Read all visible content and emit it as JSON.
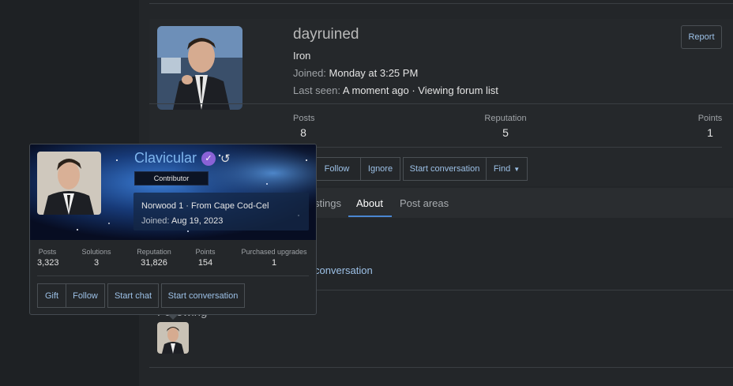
{
  "profile": {
    "username": "dayruined",
    "rank": "Iron",
    "joined_label": "Joined:",
    "joined_value": "Monday at 3:25 PM",
    "last_seen_label": "Last seen:",
    "last_seen_value": "A moment ago · Viewing forum list",
    "report_label": "Report",
    "stats": [
      {
        "label": "Posts",
        "value": "8"
      },
      {
        "label": "Reputation",
        "value": "5"
      },
      {
        "label": "Points",
        "value": "1"
      }
    ],
    "actions": {
      "follow": "Follow",
      "ignore": "Ignore",
      "start_conversation": "Start conversation",
      "find": "Find"
    },
    "tabs": {
      "postings_partial": "stings",
      "about": "About",
      "post_areas": "Post areas"
    },
    "conversation_link_partial": "conversation",
    "following_label_partial": "Following"
  },
  "popup": {
    "name": "Clavicular",
    "badge": "Contributor",
    "location": "Norwood 1 · From Cape Cod-Cel",
    "joined_label": "Joined:",
    "joined_value": "Aug 19, 2023",
    "stats": [
      {
        "label": "Posts",
        "value": "3,323"
      },
      {
        "label": "Solutions",
        "value": "3"
      },
      {
        "label": "Reputation",
        "value": "31,826"
      },
      {
        "label": "Points",
        "value": "154"
      },
      {
        "label": "Purchased upgrades",
        "value": "1"
      }
    ],
    "buttons": {
      "gift": "Gift",
      "follow": "Follow",
      "start_chat": "Start chat",
      "start_conversation": "Start conversation"
    }
  },
  "icons": {
    "verified": "verified-check-icon",
    "history": "history-icon",
    "find_caret": "caret-down-icon"
  },
  "colors": {
    "accent_link": "#9cc0e6",
    "username_blue": "#7fb6ee",
    "verified_purple": "#8a62d6",
    "tab_underline": "#4a86d1"
  }
}
